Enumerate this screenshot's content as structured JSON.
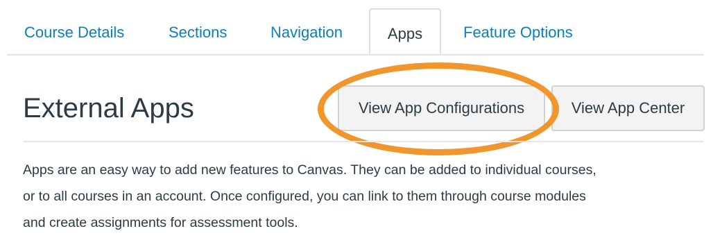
{
  "tabs": [
    {
      "label": "Course Details"
    },
    {
      "label": "Sections"
    },
    {
      "label": "Navigation"
    },
    {
      "label": "Apps",
      "active": true
    },
    {
      "label": "Feature Options"
    }
  ],
  "header": {
    "title": "External Apps",
    "view_app_configurations_label": "View App Configurations",
    "view_app_center_label": "View App Center"
  },
  "description": {
    "lines": [
      "Apps are an easy way to add new features to Canvas. They can be added to individual courses,",
      "or to all courses in an account. Once configured, you can link to them through course modules",
      "and create assignments for assessment tools."
    ]
  },
  "colors": {
    "link": "#0b7fb8",
    "text": "#2d3b45",
    "highlight": "#f0962c",
    "button_bg": "#f3f3f3"
  }
}
